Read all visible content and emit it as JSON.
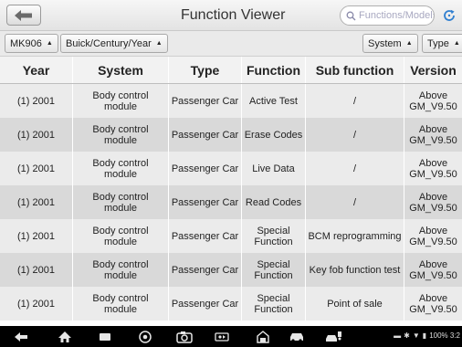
{
  "header": {
    "title": "Function Viewer",
    "search_placeholder": "Functions/Models",
    "back_icon": "back-arrow-icon",
    "refresh_icon": "refresh-icon",
    "search_icon": "search-icon"
  },
  "filters": {
    "model": "MK906",
    "vehicle": "Buick/Century/Year",
    "system": "System",
    "type": "Type"
  },
  "table": {
    "columns": [
      "Year",
      "System",
      "Type",
      "Function",
      "Sub function",
      "Version"
    ],
    "rows": [
      [
        "(1) 2001",
        "Body control module",
        "Passenger Car",
        "Active Test",
        "/",
        "Above GM_V9.50"
      ],
      [
        "(1) 2001",
        "Body control module",
        "Passenger Car",
        "Erase Codes",
        "/",
        "Above GM_V9.50"
      ],
      [
        "(1) 2001",
        "Body control module",
        "Passenger Car",
        "Live Data",
        "/",
        "Above GM_V9.50"
      ],
      [
        "(1) 2001",
        "Body control module",
        "Passenger Car",
        "Read Codes",
        "/",
        "Above GM_V9.50"
      ],
      [
        "(1) 2001",
        "Body control module",
        "Passenger Car",
        "Special Function",
        "BCM reprogramming",
        "Above GM_V9.50"
      ],
      [
        "(1) 2001",
        "Body control module",
        "Passenger Car",
        "Special Function",
        "Key fob function test",
        "Above GM_V9.50"
      ],
      [
        "(1) 2001",
        "Body control module",
        "Passenger Car",
        "Special Function",
        "Point of sale",
        "Above GM_V9.50"
      ]
    ]
  },
  "navbar": {
    "icons": [
      "back-icon",
      "home-icon",
      "recent-apps-icon",
      "chrome-icon",
      "camera-icon",
      "vci-icon",
      "garage-icon",
      "car-icon",
      "car-service-icon"
    ],
    "status_text": "100% 3:2",
    "status_icons": [
      "message-icon",
      "bluetooth-icon",
      "wifi-icon",
      "battery-icon"
    ]
  }
}
